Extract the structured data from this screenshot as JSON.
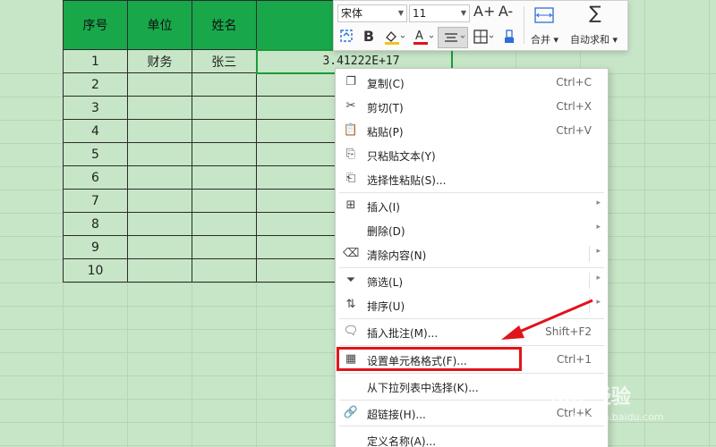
{
  "table": {
    "headers": [
      "序号",
      "单位",
      "姓名",
      ""
    ],
    "rows": [
      [
        "1",
        "财务",
        "张三",
        "3.41222E+17"
      ],
      [
        "2",
        "",
        "",
        ""
      ],
      [
        "3",
        "",
        "",
        ""
      ],
      [
        "4",
        "",
        "",
        ""
      ],
      [
        "5",
        "",
        "",
        ""
      ],
      [
        "6",
        "",
        "",
        ""
      ],
      [
        "7",
        "",
        "",
        ""
      ],
      [
        "8",
        "",
        "",
        ""
      ],
      [
        "9",
        "",
        "",
        ""
      ],
      [
        "10",
        "",
        "",
        ""
      ]
    ]
  },
  "toolbar": {
    "font_name": "宋体",
    "font_size": "11",
    "grow_font": "A+",
    "shrink_font": "A-",
    "bold": "B",
    "fill_color": "#f0c419",
    "font_color": "#e0141b",
    "merge_label": "合并",
    "autosum_label": "自动求和"
  },
  "menu": {
    "items": [
      {
        "label": "复制(C)",
        "shortcut": "Ctrl+C",
        "icon": "copy-icon"
      },
      {
        "label": "剪切(T)",
        "shortcut": "Ctrl+X",
        "icon": "scissors-icon"
      },
      {
        "label": "粘贴(P)",
        "shortcut": "Ctrl+V",
        "icon": "paste-icon"
      },
      {
        "label": "只粘贴文本(Y)",
        "shortcut": "",
        "icon": "paste-text-icon"
      },
      {
        "label": "选择性粘贴(S)...",
        "shortcut": "",
        "icon": "paste-special-icon"
      },
      {
        "label": "插入(I)",
        "shortcut": "",
        "icon": "insert-icon"
      },
      {
        "label": "删除(D)",
        "shortcut": "",
        "icon": ""
      },
      {
        "label": "清除内容(N)",
        "shortcut": "",
        "icon": "eraser-icon"
      },
      {
        "label": "筛选(L)",
        "shortcut": "",
        "icon": "filter-icon"
      },
      {
        "label": "排序(U)",
        "shortcut": "",
        "icon": "sort-icon"
      },
      {
        "label": "插入批注(M)...",
        "shortcut": "Shift+F2",
        "icon": "comment-icon"
      },
      {
        "label": "设置单元格格式(F)...",
        "shortcut": "Ctrl+1",
        "icon": "format-cells-icon"
      },
      {
        "label": "从下拉列表中选择(K)...",
        "shortcut": "",
        "icon": ""
      },
      {
        "label": "超链接(H)...",
        "shortcut": "Ctrl+K",
        "icon": "link-icon"
      },
      {
        "label": "定义名称(A)...",
        "shortcut": "",
        "icon": ""
      }
    ]
  },
  "watermark": {
    "text": "Bai 经验",
    "sub": "jingyan.baidu.com"
  },
  "colors": {
    "header_green": "#18a84a",
    "sheet_bg": "#c7e6c7",
    "highlight_red": "#e0141b"
  }
}
